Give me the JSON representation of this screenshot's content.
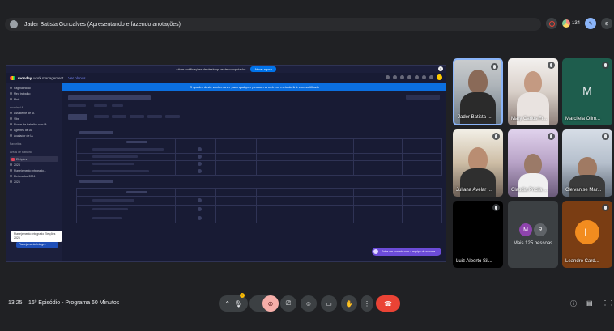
{
  "presenter": {
    "text": "Jader Batista Goncalves (Apresentando e fazendo anotações)"
  },
  "top_right": {
    "participant_count": "134"
  },
  "shared_screen": {
    "notification": {
      "text": "Ativar notificações de desktop neste computador",
      "button": "Ativar agora"
    },
    "header": {
      "brand": "monday",
      "brand_suffix": "work management",
      "see_plans": "Ver planos"
    },
    "banner": "O quadro deste work станет para qualquer pessoa na web por meio do link compartilhado",
    "sidebar": {
      "items": [
        "Página inicial",
        "Meu trabalho",
        "Mais"
      ],
      "section_label": "monday IA",
      "ai_items": [
        "Assistente de IA",
        "Vibe",
        "Fluxos de trabalho com IA",
        "Agentes de IA",
        "Avaliador de IA"
      ],
      "favorites_label": "Favoritos",
      "workspace_label": "Áreas de trabalho",
      "workspace_name": "Eleições",
      "folders": [
        "2024",
        "Planejamento integrado...",
        "Eleitorados 2024",
        "2026"
      ],
      "tooltip": "Planejamento Integrado Eleições 2026",
      "selected_board": "Planejamento Integr..."
    },
    "support_button": "Entre em contato com a equipe de suporte"
  },
  "participants": [
    {
      "name": "Jader Batista ...",
      "type": "camera"
    },
    {
      "name": "Mary Carlos Fr...",
      "type": "camera"
    },
    {
      "name": "Marcileia Olim...",
      "type": "letter",
      "letter": "M"
    },
    {
      "name": "Juliana Avelar ...",
      "type": "camera"
    },
    {
      "name": "Claudia Pricila ...",
      "type": "camera"
    },
    {
      "name": "Clelvanise Mar...",
      "type": "camera"
    },
    {
      "name": "Luiz Alberto Sil...",
      "type": "dark"
    },
    {
      "name": "Mais 125 pessoas",
      "type": "more",
      "letters": [
        "M",
        "R"
      ]
    },
    {
      "name": "Leandro Card...",
      "type": "letter",
      "letter": "L"
    }
  ],
  "bottom_bar": {
    "time": "13:25",
    "meeting_title": "16º Episódio - Programa 60 Minutos",
    "mic_badge": "!"
  },
  "colors": {
    "end_call": "#ea4335",
    "accent_blue": "#8ab4f8",
    "avatar_purple": "#8e44ad",
    "avatar_gray": "#5f6368",
    "avatar_orange": "#f28c1f"
  }
}
